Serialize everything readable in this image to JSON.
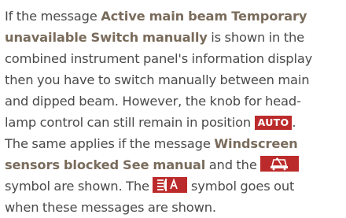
{
  "paragraph": {
    "l1_pre": "If the message ",
    "l1_bold": "Active main beam Temporary",
    "l2_bold": "unavailable Switch manually",
    "l2_post": " is shown in the",
    "l3": "combined instrument panel's information display",
    "l4": "then you have to switch manually between main",
    "l5": "and dipped beam. However, the knob for head-",
    "l6_pre": "lamp control can still remain in position ",
    "auto_badge": "AUTO",
    "l6_post": ".",
    "l7_pre": "The same applies if the message ",
    "l7_bold": "Windscreen",
    "l8_bold": "sensors blocked See manual",
    "l8_post": " and the ",
    "l9_pre": "symbol are shown. The ",
    "l9_post": " symbol goes out",
    "l10": "when these messages are shown."
  },
  "symbols": {
    "windscreen_sensor": "windscreen-sensor-icon",
    "auto_main_beam": "auto-main-beam-icon",
    "symbol_color": "#bc2b2b",
    "highlight_color": "#7a6c5c",
    "text_color": "#4a4a4a"
  }
}
